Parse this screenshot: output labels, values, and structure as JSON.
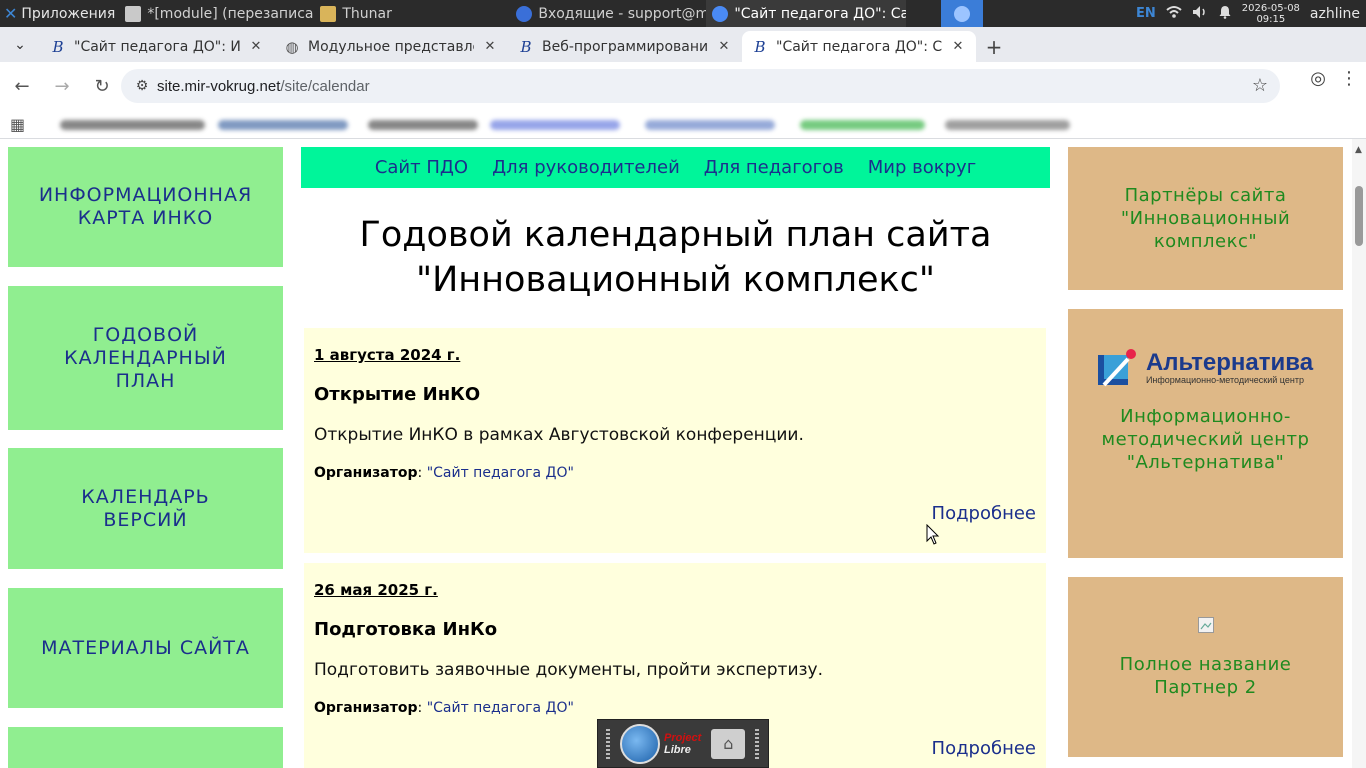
{
  "taskbar": {
    "apps_label": "Приложения",
    "tasks": [
      {
        "label": "*[module] (перезаписано..."
      },
      {
        "label": "Thunar"
      },
      {
        "label": "Входящие - support@mir..."
      },
      {
        "label": "\"Сайт педагога ДО\": Сайт..."
      }
    ],
    "lang": "EN",
    "date": "2026-05-08",
    "time": "09:15",
    "user": "azhline"
  },
  "browser": {
    "tabs": [
      {
        "title": "\"Сайт педагога ДО\": Инно"
      },
      {
        "title": "Модульное представлени"
      },
      {
        "title": "Веб-программирование в"
      },
      {
        "title": "\"Сайт педагога ДО\": Сайт"
      }
    ],
    "url_host": "site.mir-vokrug.net",
    "url_path": "/site/calendar"
  },
  "site": {
    "top_nav": [
      "Сайт ПДО",
      "Для руководителей",
      "Для педагогов",
      "Мир вокруг"
    ],
    "page_title_line1": "Годовой календарный план сайта",
    "page_title_line2": "\"Инновационный комплекс\"",
    "left_menu": [
      "ИНФОРМАЦИОННАЯ КАРТА ИНКО",
      "ГОДОВОЙ КАЛЕНДАРНЫЙ ПЛАН",
      "КАЛЕНДАРЬ ВЕРСИЙ",
      "МАТЕРИАЛЫ САЙТА"
    ],
    "events": [
      {
        "date": "1 августа 2024 г.",
        "name": "Открытие ИнКО",
        "description": "Открытие ИнКО в рамках Августовской конференции.",
        "organizer_label": "Организатор",
        "organizer": "\"Сайт педагога ДО\"",
        "more": "Подробнее"
      },
      {
        "date": "26 мая 2025 г.",
        "name": "Подготовка ИнКо",
        "description": "Подготовить заявочные документы, пройти экспертизу.",
        "organizer_label": "Организатор",
        "organizer": "\"Сайт педагога ДО\"",
        "more": "Подробнее"
      }
    ],
    "right_cards": {
      "partners_title": "Партнёры сайта \"Инновационный комплекс\"",
      "alt_logo_name": "Альтернатива",
      "alt_logo_sub": "Информационно-методический центр",
      "alt_caption": "Информационно-методический центр \"Альтернатива\"",
      "partner2_caption": "Полное название Партнер 2"
    }
  },
  "dock": {
    "app_word1": "Project",
    "app_word2": "Libre"
  }
}
